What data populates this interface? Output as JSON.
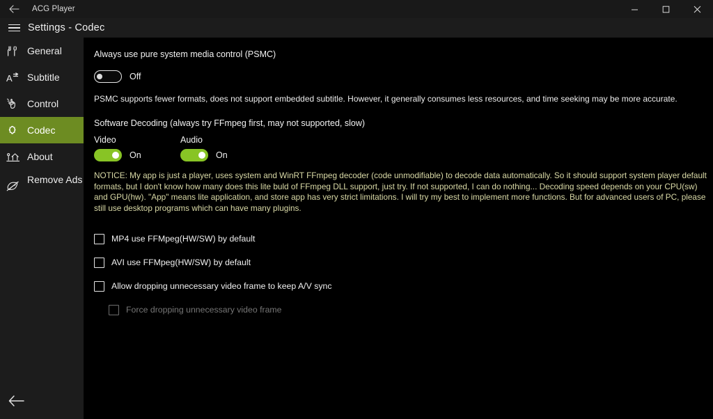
{
  "titlebar": {
    "back_icon": "back-arrow-icon",
    "app_title": "ACG Player",
    "minimize_label": "─",
    "maximize_label": "□",
    "close_label": "✕"
  },
  "header": {
    "menu_icon": "hamburger-menu-icon",
    "title": "Settings  -  Codec"
  },
  "sidebar": {
    "accent_color": "#6d8c22",
    "back_icon": "back-arrow-icon",
    "items": [
      {
        "label": "General",
        "icon": "tools-icon",
        "selected": false
      },
      {
        "label": "Subtitle",
        "icon": "subtitle-icon",
        "selected": false
      },
      {
        "label": "Control",
        "icon": "hand-click-icon",
        "selected": false
      },
      {
        "label": "Codec",
        "icon": "puzzle-icon",
        "selected": true
      },
      {
        "label": "About",
        "icon": "home-info-icon",
        "selected": false
      },
      {
        "label": "Remove Ads",
        "icon": "leaf-icon",
        "selected": false
      }
    ]
  },
  "main": {
    "psmc": {
      "title": "Always use pure system media control (PSMC)",
      "toggle_state": "off",
      "toggle_label": "Off",
      "description": "PSMC supports fewer formats, does not support embedded subtitle. However, it generally consumes less resources, and time seeking may be more accurate."
    },
    "software_decoding": {
      "title": "Software Decoding (always try FFmpeg first, may not supported, slow)",
      "video": {
        "header": "Video",
        "toggle_state": "on",
        "toggle_label": "On"
      },
      "audio": {
        "header": "Audio",
        "toggle_state": "on",
        "toggle_label": "On"
      }
    },
    "notice": {
      "color": "#d9d9a6",
      "text": "NOTICE: My app is just a player, uses system and WinRT FFmpeg decoder (code unmodifiable) to decode data automatically. So it should support system player default formats, but I don't know how many does this lite buld of FFmpeg DLL support, just try. If not supported, I can do nothing... Decoding speed depends on your CPU(sw) and GPU(hw). \"App\" means lite application, and store app has very strict limitations. I will try my best to implement more functions. But for advanced users of PC, please still use desktop programs which can have many plugins."
    },
    "checkboxes": [
      {
        "label": "MP4 use FFMpeg(HW/SW) by default",
        "checked": false,
        "disabled": false,
        "indent": false
      },
      {
        "label": "AVI use FFMpeg(HW/SW) by default",
        "checked": false,
        "disabled": false,
        "indent": false
      },
      {
        "label": "Allow dropping unnecessary video frame to keep A/V sync",
        "checked": false,
        "disabled": false,
        "indent": false
      },
      {
        "label": "Force dropping unnecessary video frame",
        "checked": false,
        "disabled": true,
        "indent": true
      }
    ]
  }
}
